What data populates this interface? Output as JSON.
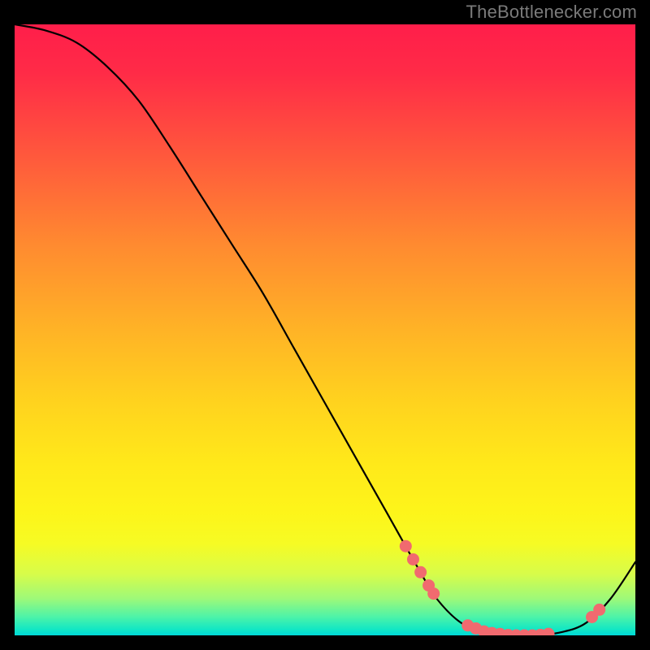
{
  "attribution": "TheBottlenecker.com",
  "chart_data": {
    "type": "line",
    "title": "",
    "xlabel": "",
    "ylabel": "",
    "xlim": [
      0,
      100
    ],
    "ylim": [
      0,
      100
    ],
    "series": [
      {
        "name": "curve",
        "x": [
          0,
          5,
          10,
          15,
          20,
          25,
          30,
          35,
          40,
          45,
          50,
          55,
          60,
          65,
          68,
          72,
          76,
          80,
          84,
          88,
          92,
          96,
          100
        ],
        "y": [
          100,
          99,
          97,
          93,
          87.5,
          80,
          72,
          64,
          56,
          47,
          38,
          29,
          20,
          11,
          6,
          2,
          0.5,
          0,
          0,
          0.5,
          2,
          6,
          12
        ]
      }
    ],
    "dot_clusters": [
      {
        "xs": [
          63.0,
          64.2,
          65.4,
          66.7,
          67.5
        ],
        "y_at": "descent"
      },
      {
        "xs": [
          73.0,
          74.3,
          75.6,
          76.9,
          78.2,
          79.5,
          80.8,
          82.1,
          83.4,
          84.7,
          86.0
        ],
        "y_at": "bottom"
      },
      {
        "xs": [
          93.0,
          94.2
        ],
        "y_at": "ascent"
      }
    ],
    "colors": {
      "line": "#000000",
      "dots": "#f16a6f",
      "gradient_top": "#ff1e4a",
      "gradient_bottom": "#00d8d8"
    }
  }
}
